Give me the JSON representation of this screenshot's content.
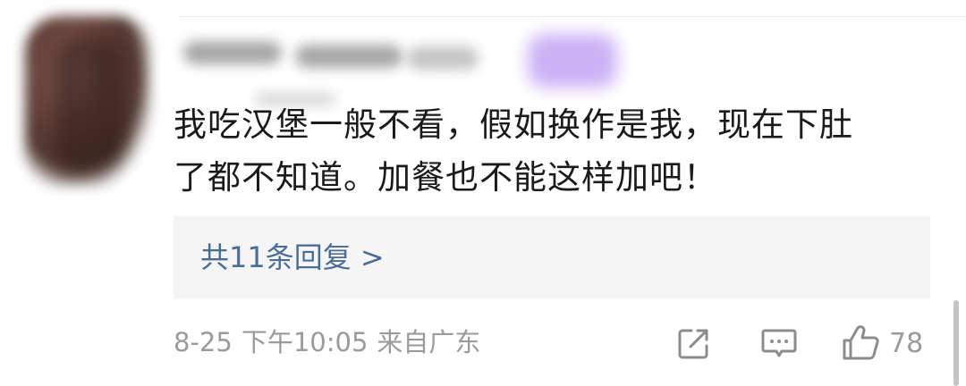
{
  "comment": {
    "text_line1": "我吃汉堡一般不看，假如换作是我，现在下肚",
    "text_line2": "了都不知道。加餐也不能这样加吧！",
    "replies_label": "共11条回复 >",
    "date": "8-25",
    "time": "下午10:05",
    "location": "来自广东",
    "likes": "78"
  },
  "icons": {
    "share": "share-icon",
    "reply": "comment-icon",
    "like": "thumbs-up-icon"
  },
  "colors": {
    "link": "#4a6d96",
    "meta": "#9a9a9a",
    "text": "#1a1a1a",
    "reply_box_bg": "#f5f5f5"
  }
}
